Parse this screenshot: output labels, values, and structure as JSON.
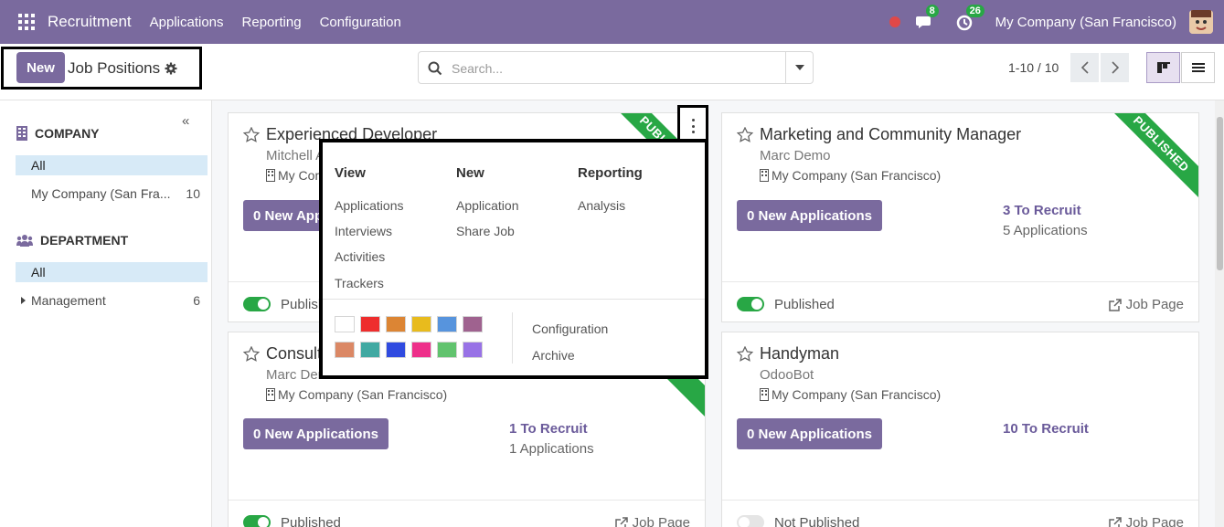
{
  "navbar": {
    "brand": "Recruitment",
    "menu": [
      "Applications",
      "Reporting",
      "Configuration"
    ],
    "chat_badge": "8",
    "activity_badge": "26",
    "company": "My Company (San Francisco)"
  },
  "control": {
    "new_label": "New",
    "title": "Job Positions",
    "search_placeholder": "Search...",
    "pager": "1-10 / 10"
  },
  "sidebar": {
    "company_header": "COMPANY",
    "company_items": [
      {
        "label": "All",
        "count": ""
      },
      {
        "label": "My Company (San Fra...",
        "count": "10"
      }
    ],
    "department_header": "DEPARTMENT",
    "department_items": [
      {
        "label": "All",
        "count": ""
      },
      {
        "label": "Management",
        "count": "6"
      }
    ]
  },
  "cards": [
    {
      "title": "Experienced Developer",
      "responsible": "Mitchell A",
      "company": "My Com",
      "button": "0 New Appli",
      "to_recruit": "",
      "applications": "",
      "status": "Publish",
      "published": true,
      "ribbon": "PUBLISHED",
      "job_page": ""
    },
    {
      "title": "Marketing and Community Manager",
      "responsible": "Marc Demo",
      "company": "My Company (San Francisco)",
      "button": "0 New Applications",
      "to_recruit": "3 To Recruit",
      "applications": "5 Applications",
      "status": "Published",
      "published": true,
      "ribbon": "PUBLISHED",
      "job_page": "Job Page"
    },
    {
      "title": "Consult",
      "responsible": "Marc Der",
      "company": "My Company (San Francisco)",
      "button": "0 New Applications",
      "to_recruit": "1 To Recruit",
      "applications": "1 Applications",
      "status": "Published",
      "published": true,
      "ribbon": "ED",
      "job_page": "Job Page"
    },
    {
      "title": "Handyman",
      "responsible": "OdooBot",
      "company": "My Company (San Francisco)",
      "button": "0 New Applications",
      "to_recruit": "10 To Recruit",
      "applications": "",
      "status": "Not Published",
      "published": false,
      "ribbon": "",
      "job_page": "Job Page"
    }
  ],
  "dropdown": {
    "view_header": "View",
    "view_items": [
      "Applications",
      "Interviews",
      "Activities",
      "Trackers"
    ],
    "new_header": "New",
    "new_items": [
      "Application",
      "Share Job"
    ],
    "reporting_header": "Reporting",
    "reporting_items": [
      "Analysis"
    ],
    "colors": [
      "#ffffff",
      "#ee2d2d",
      "#dc8534",
      "#e8bb1d",
      "#5794dd",
      "#9f628f",
      "#db8865",
      "#41a9a2",
      "#304be0",
      "#ee2f8a",
      "#61c36e",
      "#9872e6"
    ],
    "extra_items": [
      "Configuration",
      "Archive"
    ]
  },
  "colors": {
    "primary": "#7a6a9e",
    "published_green": "#28a745",
    "active_filter": "#d7eaf7"
  }
}
